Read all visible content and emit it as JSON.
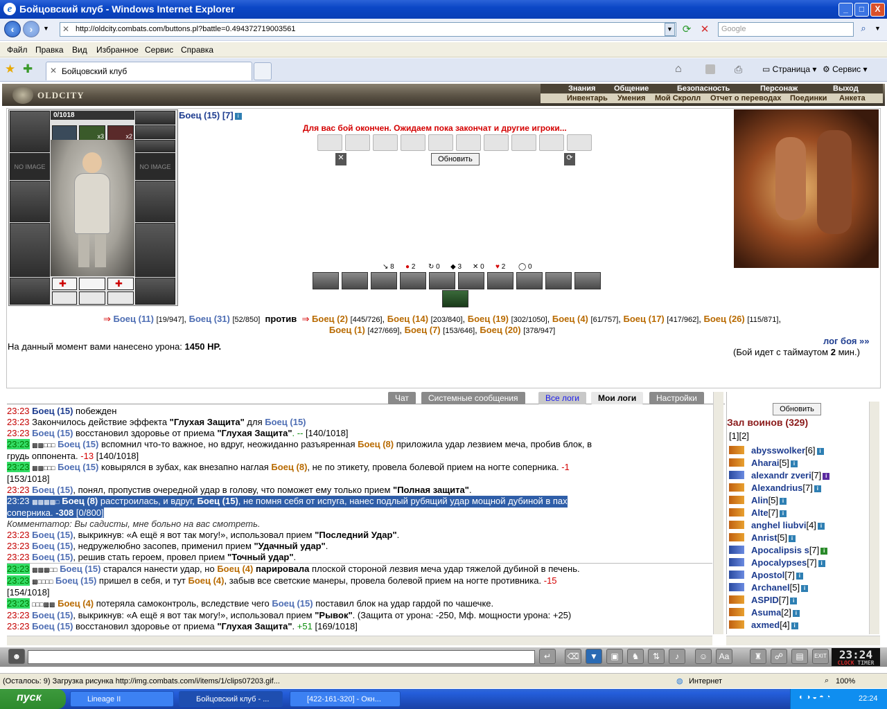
{
  "window": {
    "title": "Бойцовский клуб - Windows Internet Explorer",
    "min": "_",
    "max": "□",
    "close": "X"
  },
  "browser": {
    "address": "http://oldcity.combats.com/buttons.pl?battle=0.494372719003561",
    "search_placeholder": "Google",
    "menu": [
      "Файл",
      "Правка",
      "Вид",
      "Избранное",
      "Сервис",
      "Справка"
    ],
    "tab": "Бойцовский клуб",
    "tools": [
      "Страница",
      "Сервис"
    ]
  },
  "game_header": {
    "logo": "OLDCITY",
    "nav_top": [
      "Знания",
      "Общение",
      "Безопасность",
      "Персонаж",
      "Выход"
    ],
    "nav_bottom": [
      "Инвентарь",
      "Умения",
      "Мой Скролл",
      "Отчет о переводах",
      "Поединки",
      "Анкета"
    ]
  },
  "character": {
    "hp": "0/1018",
    "name": "Боец (15) [7]",
    "noimage": "NO IMAGE",
    "x3": "x3",
    "x2": "x2"
  },
  "battle": {
    "message": "Для вас бой окончен. Ожидаем пока закончат и другие игроки...",
    "refresh": "Обновить",
    "stats": [
      "8",
      "2",
      "0",
      "3",
      "0",
      "2",
      "0"
    ],
    "left_team": [
      {
        "name": "Боец (11)",
        "hp": "[19/947]"
      },
      {
        "name": "Боец (31)",
        "hp": "[52/850]"
      }
    ],
    "against": "против",
    "right_team_row1": [
      {
        "name": "Боец (2)",
        "hp": "[445/726]"
      },
      {
        "name": "Боец (14)",
        "hp": "[203/840]"
      },
      {
        "name": "Боец (19)",
        "hp": "[302/1050]"
      },
      {
        "name": "Боец (4)",
        "hp": "[61/757]"
      },
      {
        "name": "Боец (17)",
        "hp": "[417/962]"
      },
      {
        "name": "Боец (26)",
        "hp": "[115/871]"
      }
    ],
    "right_team_row2": [
      {
        "name": "Боец (1)",
        "hp": "[427/669]"
      },
      {
        "name": "Боец (7)",
        "hp": "[153/646]"
      },
      {
        "name": "Боец (20)",
        "hp": "[378/947]"
      }
    ],
    "damage_label": "На данный момент вами нанесено урона:",
    "damage_value": "1450 HP.",
    "log_link": "лог боя »»",
    "timeout_pre": "(Бой идет с таймаутом",
    "timeout_val": "2",
    "timeout_post": "мин.)"
  },
  "log_tabs": [
    "Чат",
    "Системные сообщения",
    "Все логи",
    "Мои логи",
    "Настройки"
  ],
  "log": {
    "time": "23:23",
    "l1": "Боец (15)",
    "l1b": "побежден",
    "l2a": "Закончилось действие эффекта",
    "l2b": "\"Глухая Защита\"",
    "l2c": "для",
    "l2d": "Боец (15)",
    "l3a": "Боец (15)",
    "l3b": "восстановил здоровье от приема",
    "l3c": "\"Глухая Защита\"",
    "l3d": ". --",
    "l3e": "[140/1018]",
    "l4a": "Боец (15)",
    "l4b": "вспомнил что-то важное, но вдруг, неожиданно разъяренная",
    "l4c": "Боец (8)",
    "l4d": "приложила удар лезвием меча, пробив блок, в",
    "l4e": "грудь оппонента.",
    "l4f": "-13",
    "l4g": "[140/1018]",
    "l5a": "Боец (15)",
    "l5b": "ковырялся в зубах, как внезапно наглая",
    "l5c": "Боец (8)",
    "l5d": ", не по этикету, провела болевой прием на ногте соперника.",
    "l5e": "-1",
    "l5f": "[153/1018]",
    "l6a": "Боец (15)",
    "l6b": ", понял, пропустив очередной удар в голову, что поможет ему только прием",
    "l6c": "\"Полная защита\"",
    "l6d": ".",
    "l7a": "Боец (8)",
    "l7b": "расстроилась, и вдруг,",
    "l7c": "Боец (15)",
    "l7d": ", не помня себя от испуга, нанес подлый рубящий удар мощной дубиной в пах",
    "l7e": "соперника.",
    "l7f": "-308",
    "l7g": "[0/800]",
    "comment": "Комментатор: Вы садисты, мне больно на вас смотреть.",
    "l8a": "Боец (15)",
    "l8b": ", выкрикнув: «А ещё я вот так могу!», использовал прием",
    "l8c": "\"Последний Удар\"",
    "l8d": ".",
    "l9a": "Боец (15)",
    "l9b": ", недружелюбно засопев, применил прием",
    "l9c": "\"Удачный удар\"",
    "l9d": ".",
    "l10a": "Боец (15)",
    "l10b": ", решив стать героем, провел прием",
    "l10c": "\"Точный удар\"",
    "l10d": ".",
    "l11a": "Боец (15)",
    "l11b": "старался нанести удар, но",
    "l11c": "Боец (4)",
    "l11d": "парировала",
    "l11e": "плоской стороной лезвия меча удар тяжелой дубиной в печень.",
    "l12a": "Боец (15)",
    "l12b": "пришел в себя, и тут",
    "l12c": "Боец (4)",
    "l12d": ", забыв все светские манеры, провела болевой прием на ногте противника.",
    "l12e": "-15",
    "l12f": "[154/1018]",
    "l13a": "Боец (4)",
    "l13b": "потеряла самоконтроль, вследствие чего",
    "l13c": "Боец (15)",
    "l13d": "поставил блок на удар гардой по чашечке.",
    "l14a": "Боец (15)",
    "l14b": ", выкрикнув: «А ещё я вот так могу!», использовал прием",
    "l14c": "\"Рывок\"",
    "l14d": ". (Защита от урона: -250, Мф. мощности урона: +25)",
    "l15a": "Боец (15)",
    "l15b": "восстановил здоровье от приема",
    "l15c": "\"Глухая Защита\"",
    "l15d": ".",
    "l15e": "+51",
    "l15f": "[169/1018]"
  },
  "room": {
    "refresh": "Обновить",
    "title": "Зал воинов (329)",
    "pages": "[1][2]",
    "players": [
      {
        "name": "abysswolker",
        "lv": "[6]"
      },
      {
        "name": "Aharai",
        "lv": "[5]"
      },
      {
        "name": "alexandr zveri",
        "lv": "[7]"
      },
      {
        "name": "Alexandrius",
        "lv": "[7]"
      },
      {
        "name": "Alin",
        "lv": "[5]"
      },
      {
        "name": "Alte",
        "lv": "[7]"
      },
      {
        "name": "anghel liubvi",
        "lv": "[4]"
      },
      {
        "name": "Anrist",
        "lv": "[5]"
      },
      {
        "name": "Apocalipsis s",
        "lv": "[7]"
      },
      {
        "name": "Apocalypses",
        "lv": "[7]"
      },
      {
        "name": "Apostol",
        "lv": "[7]"
      },
      {
        "name": "Archanel",
        "lv": "[5]"
      },
      {
        "name": "ASPID",
        "lv": "[7]"
      },
      {
        "name": "Asuma",
        "lv": "[2]"
      },
      {
        "name": "axmed",
        "lv": "[4]"
      }
    ]
  },
  "clock": {
    "time": "23:24",
    "label1": "CLOCK",
    "label2": "TIMER"
  },
  "status": {
    "text": "(Осталось: 9) Загрузка рисунка http://img.combats.com/i/items/1/clips07203.gif...",
    "zone": "Интернет",
    "zoom": "100%"
  },
  "taskbar": {
    "start": "пуск",
    "items": [
      "Lineage II",
      "Бойцовский клуб - ...",
      "[422-161-320] - Окн..."
    ],
    "time": "22:24"
  },
  "colors": {
    "titlebar": "#0b47c6",
    "player": "#1d3c8f",
    "enemy": "#b86a00",
    "alert": "#d40000"
  }
}
